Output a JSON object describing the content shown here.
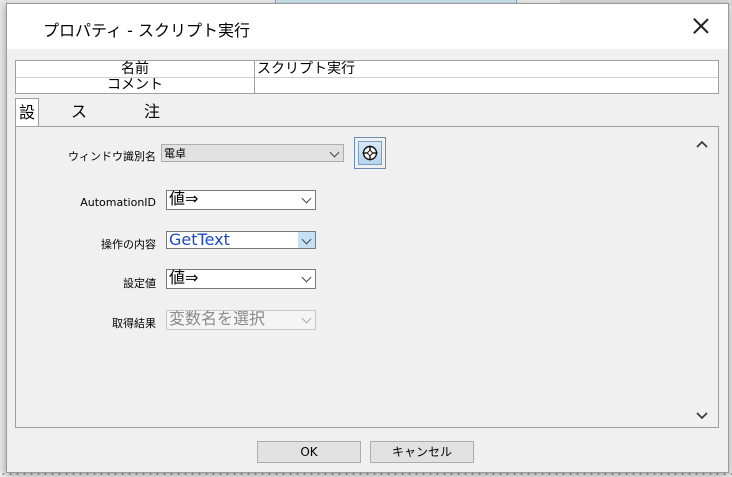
{
  "dialog": {
    "title": "プロパティ - スクリプト実行"
  },
  "properties": {
    "name_label": "名前",
    "name_value": "スクリプト実行",
    "comment_label": "コメント",
    "comment_value": ""
  },
  "tabs": [
    {
      "label": "設定",
      "active": true
    },
    {
      "label": "スクリプト",
      "active": false
    },
    {
      "label": "注釈",
      "active": false
    }
  ],
  "fields": {
    "window_label": "ウィンドウ識別名",
    "window_value": "電卓",
    "automation_label": "AutomationID",
    "automation_value": "値⇒",
    "operation_label": "操作の内容",
    "operation_value": "GetText",
    "setvalue_label": "設定値",
    "setvalue_value": "値⇒",
    "result_label": "取得結果",
    "result_placeholder": "変数名を選択"
  },
  "buttons": {
    "ok": "OK",
    "cancel": "キャンセル"
  }
}
